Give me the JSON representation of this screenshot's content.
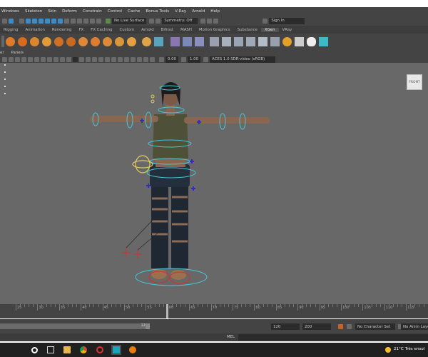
{
  "menubar": {
    "items": [
      "Windows",
      "Skeleton",
      "Skin",
      "Deform",
      "Constrain",
      "Control",
      "Cache",
      "Bonus Tools",
      "V-Ray",
      "Arnold",
      "Help"
    ]
  },
  "statusline": {
    "live_surface": "No Live Surface",
    "symmetry": "Symmetry: Off",
    "sign_in": "Sign In"
  },
  "shelf_tabs": [
    "Rigging",
    "Animation",
    "Rendering",
    "FX",
    "FX Caching",
    "Custom",
    "Arnold",
    "Bifrost",
    "MASH",
    "Motion Graphics",
    "Substance",
    "XGen",
    "VRay"
  ],
  "panel_menu": [
    "er",
    "Panels"
  ],
  "panel_tools": {
    "exposure": "0.00",
    "gamma": "1.00",
    "colorspace": "ACES 1.0 SDR-video (sRGB)"
  },
  "viewport": {
    "viewcube_label": "FRONT"
  },
  "timeline": {
    "ticks": [
      "25",
      "30",
      "35",
      "40",
      "45",
      "50",
      "55",
      "60",
      "65",
      "70",
      "75",
      "80",
      "85",
      "90",
      "95",
      "100",
      "105",
      "110",
      "115"
    ]
  },
  "range": {
    "range_end_inner": "120",
    "end_time": "120",
    "max_time": "200",
    "character_set": "No Character Set",
    "anim_layer": "No Anim Layer"
  },
  "mel": {
    "label": "MEL"
  },
  "taskbar": {
    "weather": "21°C  Très ensol"
  },
  "colors": {
    "accent": "#3a8bc9",
    "viewport_bg": "#686868",
    "control_cyan": "#44c8d8",
    "control_yellow": "#e0d060",
    "control_red": "#d03030"
  }
}
